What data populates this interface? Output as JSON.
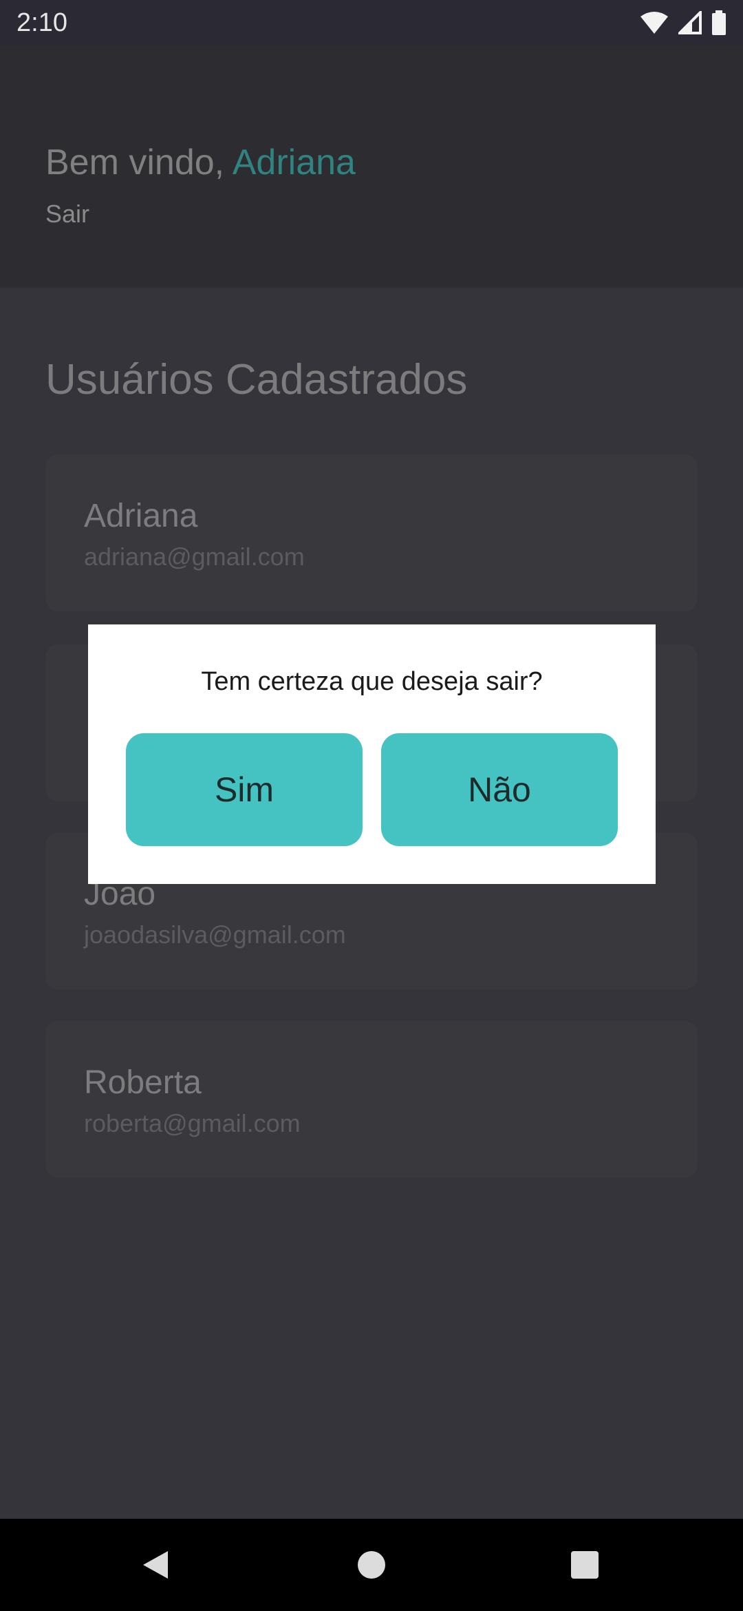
{
  "status_bar": {
    "time": "2:10",
    "icons": [
      "wifi-icon",
      "signal-icon",
      "battery-icon"
    ]
  },
  "header": {
    "welcome_prefix": "Bem vindo, ",
    "user_name": "Adriana",
    "logout_label": "Sair"
  },
  "main": {
    "section_title": "Usuários Cadastrados",
    "users": [
      {
        "name": "Adriana",
        "email": "adriana@gmail.com"
      },
      {
        "name": "",
        "email": ""
      },
      {
        "name": "Joao",
        "email": "joaodasilva@gmail.com"
      },
      {
        "name": "Roberta",
        "email": "roberta@gmail.com"
      }
    ]
  },
  "dialog": {
    "message": "Tem certeza que deseja sair?",
    "yes_label": "Sim",
    "no_label": "Não"
  },
  "nav_bar": {
    "icons": [
      "back-icon",
      "home-icon",
      "recents-icon"
    ]
  },
  "colors": {
    "accent": "#44c3c2",
    "name_highlight": "#2f8481",
    "background": "#34343a"
  }
}
